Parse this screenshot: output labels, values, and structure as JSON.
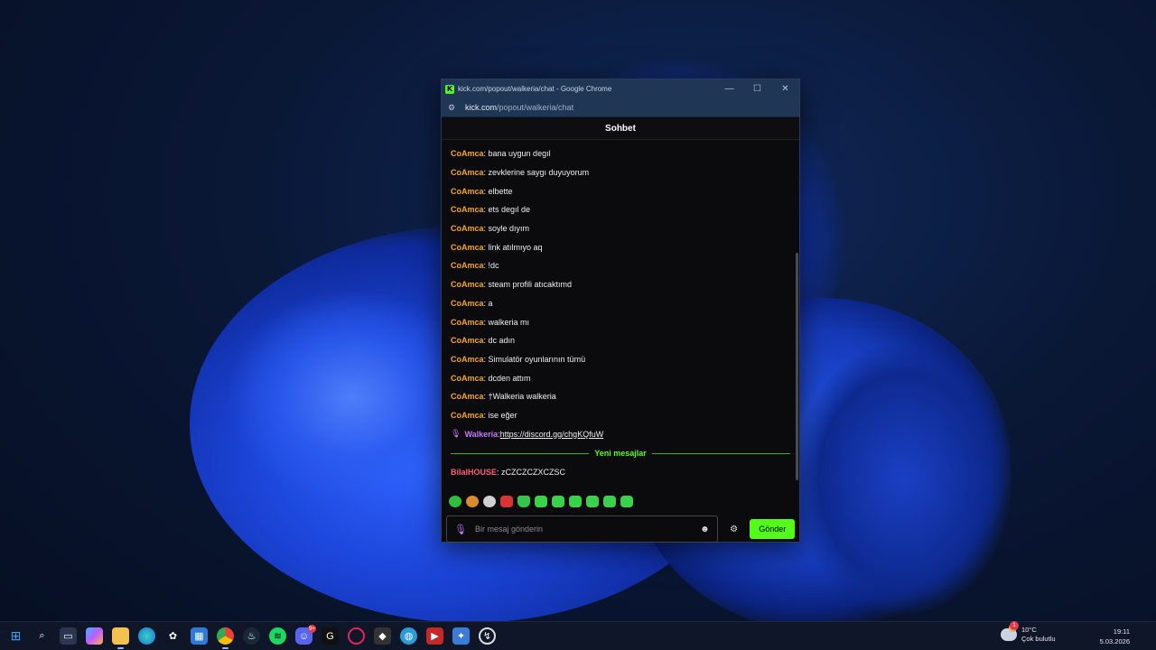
{
  "window": {
    "title": "kick.com/popout/walkeria/chat - Google Chrome",
    "url_host": "kick.com",
    "url_path": "/popout/walkeria/chat",
    "logo_letter": "K",
    "minimize": "—",
    "maximize": "☐",
    "close": "✕"
  },
  "chat": {
    "header": "Sohbet",
    "messages": [
      {
        "user": "CoAmca",
        "text": ": bana uygun degıl"
      },
      {
        "user": "CoAmca",
        "text": ": zevklerine saygı duyuyorum"
      },
      {
        "user": "CoAmca",
        "text": ": elbette"
      },
      {
        "user": "CoAmca",
        "text": ": ets degıl de"
      },
      {
        "user": "CoAmca",
        "text": ": soyle dıyım"
      },
      {
        "user": "CoAmca",
        "text": ": link atılmıyo aq"
      },
      {
        "user": "CoAmca",
        "text": ": !dc"
      },
      {
        "user": "CoAmca",
        "text": ": steam profili atıcaktımd"
      },
      {
        "user": "CoAmca",
        "text": ": a"
      },
      {
        "user": "CoAmca",
        "text": ": walkeria mı"
      },
      {
        "user": "CoAmca",
        "text": ": dc adın"
      },
      {
        "user": "CoAmca",
        "text": ": Simulatör oyunlarının tümü"
      },
      {
        "user": "CoAmca",
        "text": ": dcden attım"
      },
      {
        "user": "CoAmca",
        "text": ": †Walkeria walkeria"
      },
      {
        "user": "CoAmca",
        "text": ": ise eğer"
      }
    ],
    "host_message": {
      "user": "Walkeria",
      "separator": ": ",
      "link": "https://discord.gg/chgKQfuW"
    },
    "new_messages_label": "Yeni mesajlar",
    "new_message": {
      "user": "BilalHOUSE",
      "text": ": zCZCZCZXCZSC"
    },
    "emotes": [
      "emote-1",
      "emote-2",
      "emote-3",
      "emote-4",
      "emote-5",
      "emote-6",
      "emote-7",
      "emote-8",
      "emote-9",
      "emote-10",
      "emote-11"
    ],
    "input_placeholder": "Bir mesaj gönderin",
    "send_label": "Gönder"
  },
  "taskbar": {
    "weather_temp": "10°C",
    "weather_desc": "Çok bulutlu",
    "weather_badge": "1",
    "time": "19:11",
    "date": "5.03.2026",
    "discord_badge": "9+"
  },
  "colors": {
    "kick_green": "#53fc18",
    "username_orange": "#f5a623",
    "host_purple": "#c774ff",
    "new_user_pink": "#ff5d7a"
  }
}
